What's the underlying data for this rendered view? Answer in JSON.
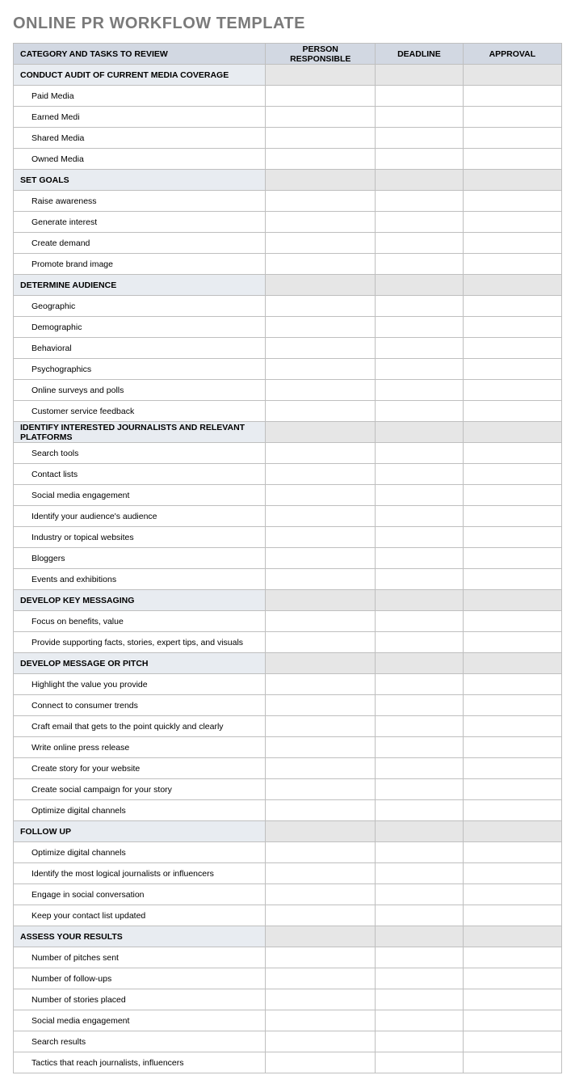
{
  "title": "ONLINE PR WORKFLOW TEMPLATE",
  "headers": {
    "category": "CATEGORY AND TASKS TO REVIEW",
    "person": "PERSON RESPONSIBLE",
    "deadline": "DEADLINE",
    "approval": "APPROVAL"
  },
  "sections": [
    {
      "name": "CONDUCT AUDIT OF CURRENT MEDIA COVERAGE",
      "tasks": [
        "Paid Media",
        "Earned Medi",
        "Shared Media",
        "Owned Media"
      ]
    },
    {
      "name": "SET GOALS",
      "tasks": [
        "Raise awareness",
        "Generate interest",
        "Create demand",
        "Promote brand image"
      ]
    },
    {
      "name": "DETERMINE AUDIENCE",
      "tasks": [
        "Geographic",
        "Demographic",
        "Behavioral",
        "Psychographics",
        "Online surveys and polls",
        "Customer service feedback"
      ]
    },
    {
      "name": "IDENTIFY INTERESTED JOURNALISTS AND RELEVANT PLATFORMS",
      "tasks": [
        "Search tools",
        "Contact lists",
        "Social media engagement",
        "Identify your audience's audience",
        "Industry or topical websites",
        "Bloggers",
        "Events and exhibitions"
      ]
    },
    {
      "name": "DEVELOP KEY MESSAGING",
      "tasks": [
        "Focus on benefits, value",
        "Provide supporting facts, stories, expert tips, and visuals"
      ]
    },
    {
      "name": "DEVELOP MESSAGE OR PITCH",
      "tasks": [
        "Highlight the value you provide",
        "Connect to consumer trends",
        "Craft email that gets to the point quickly and clearly",
        "Write online press release",
        "Create story for your website",
        "Create social campaign for your story",
        "Optimize digital channels"
      ]
    },
    {
      "name": "FOLLOW UP",
      "tasks": [
        "Optimize digital channels",
        "Identify the most logical journalists or influencers",
        "Engage in social conversation",
        "Keep your contact list updated"
      ]
    },
    {
      "name": "ASSESS YOUR RESULTS",
      "tasks": [
        "Number of pitches sent",
        "Number of follow-ups",
        "Number of stories placed",
        "Social media engagement",
        "Search results",
        "Tactics that reach journalists, influencers"
      ]
    }
  ]
}
